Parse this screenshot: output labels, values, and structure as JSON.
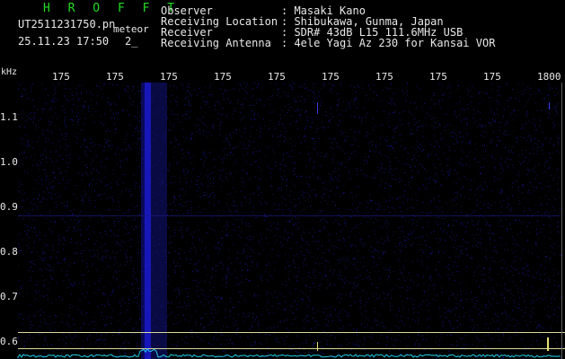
{
  "header": {
    "brand": "H R O F F T",
    "filename": "UT2511231750.pn",
    "event_label": "meteor",
    "datetime": "25.11.23 17:50",
    "count": "2_",
    "fields": [
      {
        "label": "Observer",
        "value": ": Masaki Kano"
      },
      {
        "label": "Receiving Location",
        "value": ": Shibukawa, Gunma, Japan"
      },
      {
        "label": "Receiver",
        "value": ": SDR# 43dB L15 111.6MHz USB"
      },
      {
        "label": "Receiving Antenna",
        "value": ": 4ele Yagi Az 230 for Kansai VOR"
      }
    ]
  },
  "chart_data": {
    "type": "heatmap",
    "y_unit": "kHz",
    "y_tick_labels": [
      "1.1",
      "1.0",
      "0.9",
      "0.8",
      "0.7",
      "0.6"
    ],
    "x_tick_labels": [
      "175",
      "175",
      "175",
      "175",
      "175",
      "175",
      "175",
      "175",
      "175",
      "1800"
    ],
    "colors": {
      "background": "#000000",
      "signal": "#1a1acc",
      "marker_line": "#d8d89a",
      "text": "#e8e8e8",
      "brand": "#22dd22"
    }
  }
}
